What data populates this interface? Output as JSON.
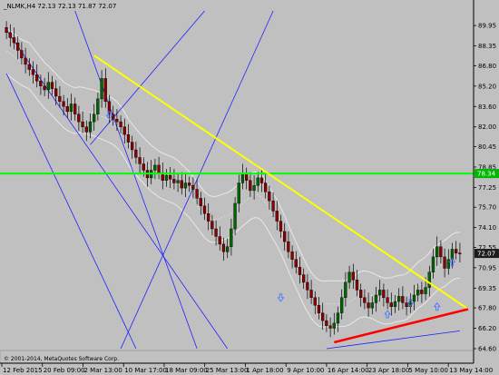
{
  "chart_data": {
    "type": "candlestick",
    "symbol_header": "_NLMK,H4  72.13 72.13 71.87 72.07",
    "watermark": "© MetaQuotes Software Corp.",
    "watermark2": "© 2001-2014, MetaQuotes Software Corp.",
    "ylim": [
      64.6,
      91.1
    ],
    "y_ticks": [
      89.95,
      88.35,
      86.8,
      85.2,
      83.6,
      82.0,
      80.45,
      78.85,
      77.25,
      75.7,
      74.1,
      72.55,
      70.95,
      69.35,
      67.8,
      66.2,
      64.6
    ],
    "last_price": "72.07",
    "level_price": "78.34",
    "x_ticks": [
      "12 Feb 2015",
      "20 Feb 09:00",
      "2 Mar 13:00",
      "10 Mar 17:00",
      "18 Mar 09:00",
      "25 Mar 13:00",
      "1 Apr 18:00",
      "9 Apr 10:00",
      "16 Apr 14:00",
      "23 Apr 18:00",
      "5 May 10:00",
      "13 May 14:00"
    ],
    "closes": [
      89.4,
      89.0,
      88.6,
      88.0,
      87.4,
      86.9,
      86.5,
      86.1,
      85.6,
      85.2,
      84.9,
      85.5,
      85.0,
      84.4,
      84.0,
      83.6,
      83.2,
      83.8,
      83.0,
      82.4,
      82.0,
      81.6,
      82.4,
      83.0,
      84.2,
      85.8,
      84.0,
      83.0,
      82.6,
      82.4,
      82.0,
      81.4,
      80.8,
      80.2,
      79.6,
      79.1,
      78.6,
      78.0,
      78.6,
      79.0,
      78.4,
      77.8,
      78.2,
      77.9,
      77.6,
      77.8,
      77.2,
      77.6,
      77.4,
      77.1,
      76.4,
      75.8,
      75.2,
      74.6,
      74.0,
      73.4,
      72.8,
      72.2,
      72.6,
      74.0,
      76.0,
      77.6,
      78.3,
      77.8,
      77.0,
      77.4,
      78.0,
      77.6,
      76.9,
      76.2,
      75.4,
      74.6,
      73.8,
      73.0,
      72.2,
      71.6,
      71.0,
      70.4,
      69.8,
      69.2,
      68.6,
      68.0,
      67.4,
      66.8,
      66.4,
      66.2,
      66.6,
      67.4,
      68.6,
      69.8,
      70.6,
      70.0,
      69.2,
      68.6,
      68.2,
      67.8,
      68.2,
      68.8,
      69.2,
      68.6,
      68.2,
      67.9,
      68.3,
      68.7,
      68.2,
      67.9,
      68.3,
      68.8,
      69.2,
      68.9,
      69.4,
      70.6,
      71.8,
      72.6,
      71.8,
      70.9,
      71.6,
      72.4,
      72.1,
      72.07
    ],
    "overlays": {
      "resistance_line_color": "#ffff00",
      "support_line_color": "#ff0000",
      "horizontal_level_color": "#00ff00",
      "channel_color": "#2020ff",
      "envelope_color": "#e8e8e8"
    },
    "colors": {
      "background": "#c0c0c0",
      "bull_candle": "#006400",
      "bear_candle": "#8b0000",
      "grid": "#9a9a9a",
      "last_price_label": "#1c1c1c",
      "level_label": "#00b800",
      "arrow": "#4a78ff"
    },
    "grid": false,
    "legend": "none"
  }
}
